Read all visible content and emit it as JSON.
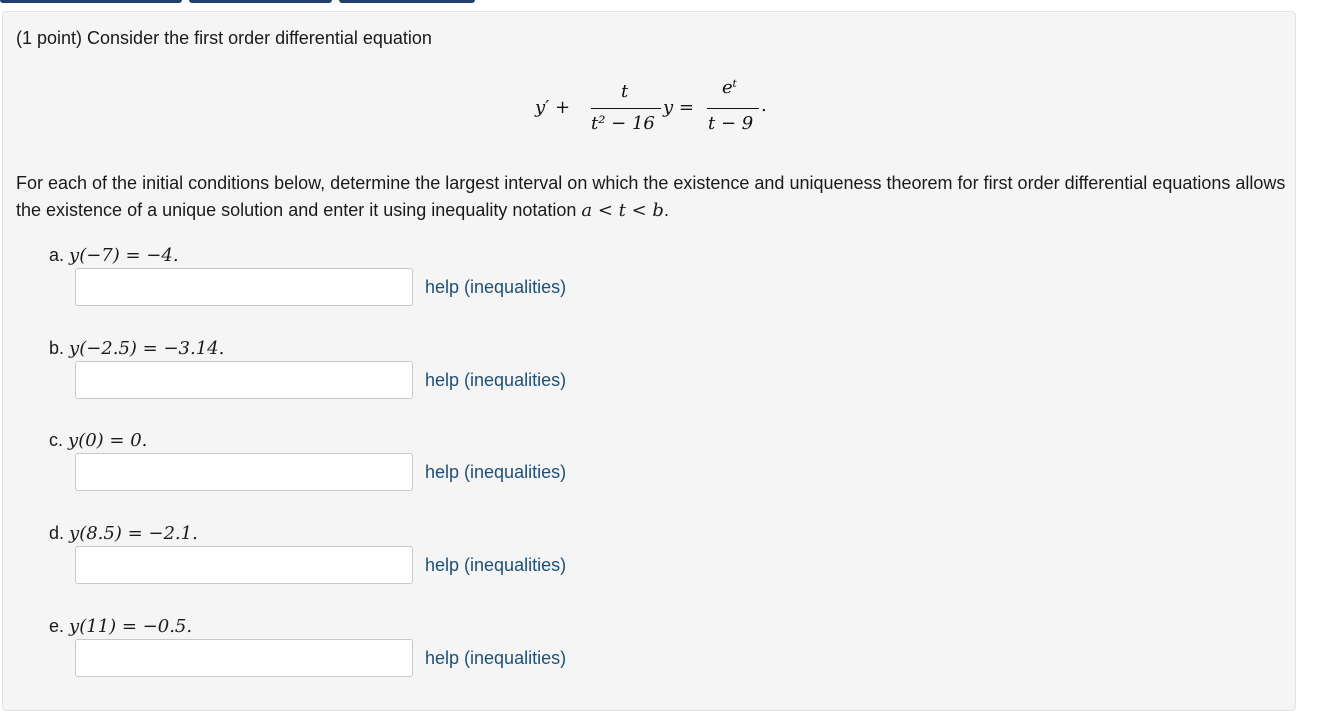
{
  "header": {
    "tabs_color": "#23406c"
  },
  "problem": {
    "intro": "(1 point) Consider the first order differential equation",
    "equation": {
      "lhs_prime": "y′ +",
      "frac1_num": "t",
      "frac1_den": "t² − 16",
      "y_equals": "y =",
      "frac2_num": "eᵗ",
      "frac2_den": "t − 9",
      "period": "."
    },
    "instructions_main": "For each of the initial conditions below, determine the largest interval on which the existence and uniqueness theorem for first order differential equations allows the existence of a unique solution and enter it using inequality notation ",
    "instructions_math": "a < t < b",
    "instructions_end": ".",
    "help_label": "help (inequalities)"
  },
  "parts": [
    {
      "letter": "a.",
      "condition": "y(−7) = −4.",
      "answer_value": "",
      "help": "help (inequalities)"
    },
    {
      "letter": "b.",
      "condition": "y(−2.5) = −3.14.",
      "answer_value": "",
      "help": "help (inequalities)"
    },
    {
      "letter": "c.",
      "condition": "y(0) = 0.",
      "answer_value": "",
      "help": "help (inequalities)"
    },
    {
      "letter": "d.",
      "condition": "y(8.5) = −2.1.",
      "answer_value": "",
      "help": "help (inequalities)"
    },
    {
      "letter": "e.",
      "condition": "y(11) = −0.5.",
      "answer_value": "",
      "help": "help (inequalities)"
    }
  ]
}
